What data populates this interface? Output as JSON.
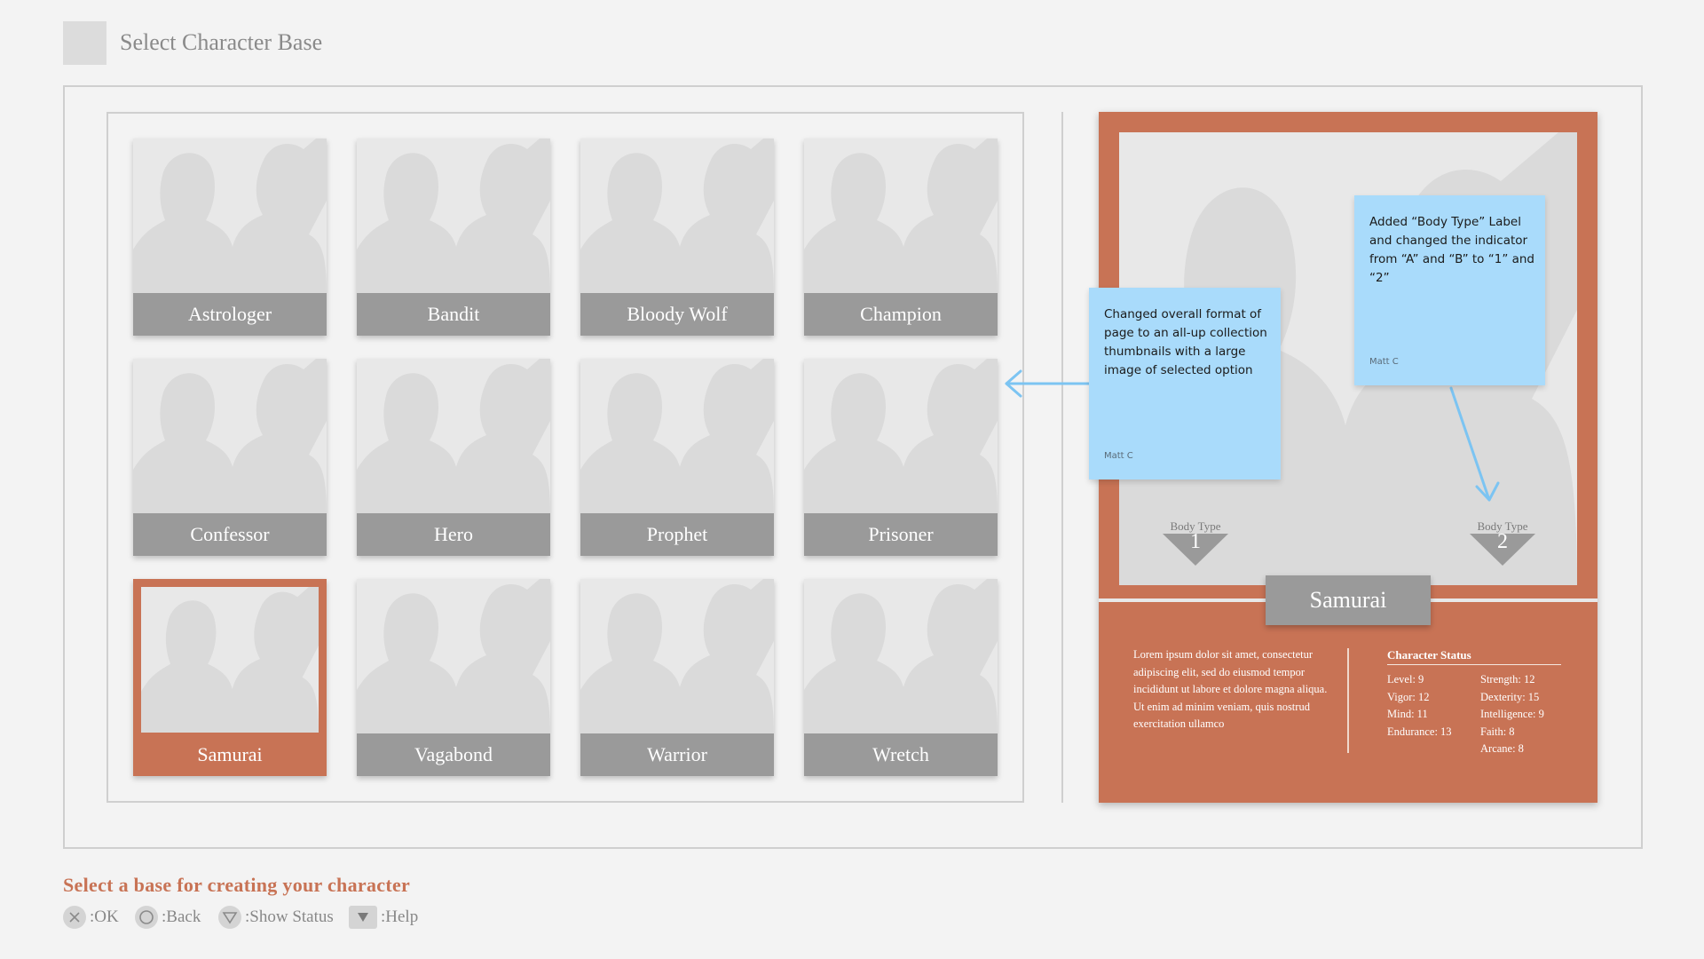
{
  "header": {
    "title": "Select Character Base"
  },
  "characters": [
    {
      "label": "Astrologer"
    },
    {
      "label": "Bandit"
    },
    {
      "label": "Bloody Wolf"
    },
    {
      "label": "Champion"
    },
    {
      "label": "Confessor"
    },
    {
      "label": "Hero"
    },
    {
      "label": "Prophet"
    },
    {
      "label": "Prisoner"
    },
    {
      "label": "Samurai",
      "selected": true
    },
    {
      "label": "Vagabond"
    },
    {
      "label": "Warrior"
    },
    {
      "label": "Wretch"
    }
  ],
  "detail": {
    "name": "Samurai",
    "body_types": [
      {
        "label": "Body Type",
        "value": "1"
      },
      {
        "label": "Body Type",
        "value": "2"
      }
    ],
    "description": "Lorem ipsum dolor sit amet, consectetur adipiscing elit, sed do eiusmod tempor incididunt ut labore et dolore magna aliqua. Ut enim ad minim veniam, quis nostrud exercitation ullamco",
    "status_title": "Character Status",
    "stats_left": [
      "Level: 9",
      "Vigor: 12",
      "Mind: 11",
      "Endurance: 13"
    ],
    "stats_right": [
      "Strength: 12",
      "Dexterity: 15",
      "Intelligence: 9",
      "Faith: 8",
      "Arcane: 8"
    ]
  },
  "notes": [
    {
      "text": "Changed overall format of page to an all-up collection thumbnails with a large image of selected option",
      "author": "Matt C"
    },
    {
      "text": "Added “Body Type” Label and changed the indicator from “A” and “B” to “1” and “2”",
      "author": "Matt C"
    }
  ],
  "footer": {
    "prompt": "Select a base for creating your character",
    "hints": [
      {
        "icon": "cross-button-icon",
        "label": ":OK"
      },
      {
        "icon": "circle-button-icon",
        "label": ":Back"
      },
      {
        "icon": "triangle-button-icon",
        "label": ":Show Status"
      },
      {
        "icon": "touchpad-button-icon",
        "label": ":Help"
      }
    ]
  },
  "colors": {
    "accent": "#c87355",
    "tile_label": "#9a9a9a",
    "note": "#a9dbfb",
    "arrow": "#7cc4f2"
  }
}
